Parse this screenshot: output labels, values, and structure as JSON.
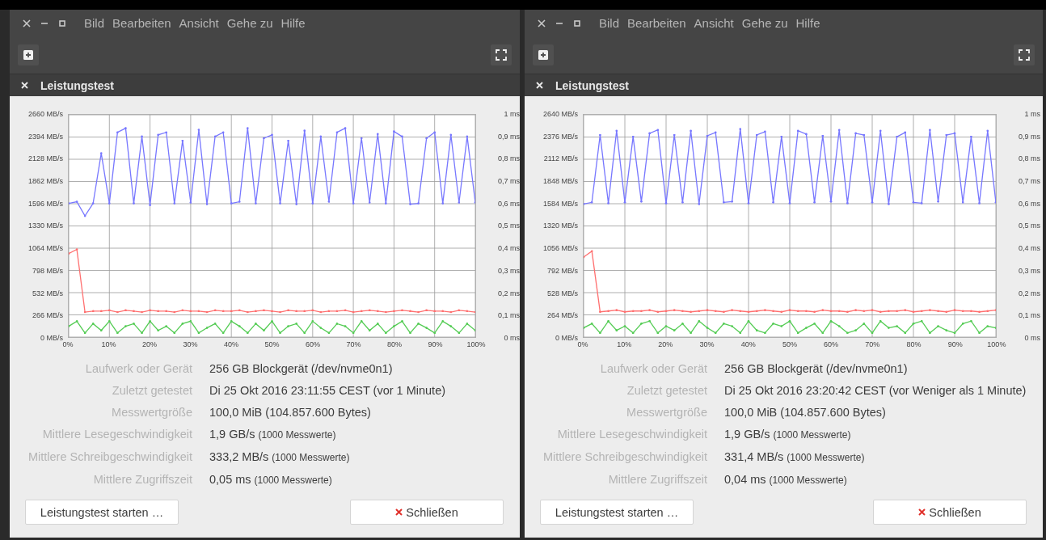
{
  "windows": [
    {
      "menu": [
        "Bild",
        "Bearbeiten",
        "Ansicht",
        "Gehe zu",
        "Hilfe"
      ],
      "dialog_title": "Leistungstest",
      "chart": {
        "y2_labels": [
          "1 ms",
          "0,9 ms",
          "0,8 ms",
          "0,7 ms",
          "0,6 ms",
          "0,5 ms",
          "0,4 ms",
          "0,3 ms",
          "0,2 ms",
          "0,1 ms",
          "0 ms"
        ],
        "chart_data": {
          "type": "line",
          "grid": true,
          "xlim": [
            0,
            100
          ],
          "ylim": [
            0,
            2660
          ],
          "x": [
            0,
            2,
            4,
            6,
            8,
            10,
            12,
            14,
            16,
            18,
            20,
            22,
            24,
            26,
            28,
            30,
            32,
            34,
            36,
            38,
            40,
            42,
            44,
            46,
            48,
            50,
            52,
            54,
            56,
            58,
            60,
            62,
            64,
            66,
            68,
            70,
            72,
            74,
            76,
            78,
            80,
            82,
            84,
            86,
            88,
            90,
            92,
            94,
            96,
            98,
            100
          ],
          "xticks": [
            {
              "value": 0,
              "label": "0%"
            },
            {
              "value": 10,
              "label": "10%"
            },
            {
              "value": 20,
              "label": "20%"
            },
            {
              "value": 30,
              "label": "30%"
            },
            {
              "value": 40,
              "label": "40%"
            },
            {
              "value": 50,
              "label": "50%"
            },
            {
              "value": 60,
              "label": "60%"
            },
            {
              "value": 70,
              "label": "70%"
            },
            {
              "value": 80,
              "label": "80%"
            },
            {
              "value": 90,
              "label": "90%"
            },
            {
              "value": 100,
              "label": "100%"
            }
          ],
          "yticks": [
            {
              "value": 2660,
              "label": "2660 MB/s"
            },
            {
              "value": 2394,
              "label": "2394 MB/s"
            },
            {
              "value": 2128,
              "label": "2128 MB/s"
            },
            {
              "value": 1862,
              "label": "1862 MB/s"
            },
            {
              "value": 1596,
              "label": "1596 MB/s"
            },
            {
              "value": 1330,
              "label": "1330 MB/s"
            },
            {
              "value": 1064,
              "label": "1064 MB/s"
            },
            {
              "value": 798,
              "label": "798 MB/s"
            },
            {
              "value": 532,
              "label": "532 MB/s"
            },
            {
              "value": 266,
              "label": "266 MB/s"
            },
            {
              "value": 0,
              "label": "0 MB/s"
            }
          ],
          "series": [
            {
              "color": "#7878ff",
              "values": [
                1600,
                1620,
                1450,
                1600,
                2200,
                1600,
                2450,
                2500,
                1600,
                2400,
                1580,
                2420,
                2450,
                1600,
                2350,
                1610,
                2480,
                1590,
                2400,
                2450,
                1600,
                1620,
                2500,
                1600,
                2380,
                2420,
                1600,
                2350,
                1590,
                2470,
                1600,
                2400,
                1620,
                2450,
                2500,
                1600,
                2380,
                1610,
                2430,
                1600,
                2460,
                2400,
                1590,
                1600,
                2380,
                2450,
                1600,
                2420,
                1610,
                2400,
                1610
              ]
            },
            {
              "color": "#ff7070",
              "values": [
                1000,
                1050,
                300,
                310,
                310,
                320,
                300,
                320,
                310,
                300,
                320,
                310,
                310,
                300,
                320,
                310,
                310,
                300,
                320,
                310,
                310,
                320,
                300,
                310,
                320,
                310,
                300,
                320,
                310,
                310,
                320,
                300,
                310,
                310,
                320,
                300,
                310,
                320,
                310,
                300,
                310,
                320,
                310,
                300,
                320,
                310,
                310,
                300,
                320,
                310,
                300
              ]
            },
            {
              "color": "#55cc55",
              "values": [
                130,
                190,
                50,
                160,
                80,
                190,
                50,
                130,
                160,
                50,
                190,
                80,
                130,
                50,
                160,
                190,
                50,
                110,
                160,
                50,
                190,
                130,
                50,
                160,
                80,
                190,
                50,
                130,
                160,
                50,
                190,
                110,
                50,
                160,
                130,
                50,
                190,
                80,
                160,
                50,
                130,
                190,
                50,
                160,
                110,
                50,
                190,
                130,
                50,
                160,
                80
              ]
            }
          ]
        }
      },
      "details": [
        {
          "label": "Laufwerk oder Gerät",
          "value": "256 GB Blockgerät (/dev/nvme0n1)"
        },
        {
          "label": "Zuletzt getestet",
          "value": "Di 25 Okt 2016 23:11:55 CEST (vor 1 Minute)"
        },
        {
          "label": "Messwertgröße",
          "value": "100,0 MiB (104.857.600 Bytes)"
        },
        {
          "label": "Mittlere Lesegeschwindigkeit",
          "value": "1,9 GB/s",
          "note": "(1000 Messwerte)"
        },
        {
          "label": "Mittlere Schreibgeschwindigkeit",
          "value": "333,2 MB/s",
          "note": "(1000 Messwerte)"
        },
        {
          "label": "Mittlere Zugriffszeit",
          "value": "0,05 ms",
          "note": "(1000 Messwerte)"
        }
      ],
      "buttons": [
        {
          "kind": "start",
          "label": "Leistungstest starten …"
        },
        {
          "kind": "close",
          "label": "Schließen"
        }
      ]
    },
    {
      "menu": [
        "Bild",
        "Bearbeiten",
        "Ansicht",
        "Gehe zu",
        "Hilfe"
      ],
      "dialog_title": "Leistungstest",
      "chart": {
        "y2_labels": [
          "1 ms",
          "0,9 ms",
          "0,8 ms",
          "0,7 ms",
          "0,6 ms",
          "0,5 ms",
          "0,4 ms",
          "0,3 ms",
          "0,2 ms",
          "0,1 ms",
          "0 ms"
        ],
        "chart_data": {
          "type": "line",
          "grid": true,
          "xlim": [
            0,
            100
          ],
          "ylim": [
            0,
            2640
          ],
          "x": [
            0,
            2,
            4,
            6,
            8,
            10,
            12,
            14,
            16,
            18,
            20,
            22,
            24,
            26,
            28,
            30,
            32,
            34,
            36,
            38,
            40,
            42,
            44,
            46,
            48,
            50,
            52,
            54,
            56,
            58,
            60,
            62,
            64,
            66,
            68,
            70,
            72,
            74,
            76,
            78,
            80,
            82,
            84,
            86,
            88,
            90,
            92,
            94,
            96,
            98,
            100
          ],
          "xticks": [
            {
              "value": 0,
              "label": "0%"
            },
            {
              "value": 10,
              "label": "10%"
            },
            {
              "value": 20,
              "label": "20%"
            },
            {
              "value": 30,
              "label": "30%"
            },
            {
              "value": 40,
              "label": "40%"
            },
            {
              "value": 50,
              "label": "50%"
            },
            {
              "value": 60,
              "label": "60%"
            },
            {
              "value": 70,
              "label": "70%"
            },
            {
              "value": 80,
              "label": "80%"
            },
            {
              "value": 90,
              "label": "90%"
            },
            {
              "value": 100,
              "label": "100%"
            }
          ],
          "yticks": [
            {
              "value": 2640,
              "label": "2640 MB/s"
            },
            {
              "value": 2376,
              "label": "2376 MB/s"
            },
            {
              "value": 2112,
              "label": "2112 MB/s"
            },
            {
              "value": 1848,
              "label": "1848 MB/s"
            },
            {
              "value": 1584,
              "label": "1584 MB/s"
            },
            {
              "value": 1320,
              "label": "1320 MB/s"
            },
            {
              "value": 1056,
              "label": "1056 MB/s"
            },
            {
              "value": 792,
              "label": "792 MB/s"
            },
            {
              "value": 528,
              "label": "528 MB/s"
            },
            {
              "value": 264,
              "label": "264 MB/s"
            },
            {
              "value": 0,
              "label": "0 MB/s"
            }
          ],
          "series": [
            {
              "color": "#7878ff",
              "values": [
                1580,
                1600,
                2400,
                1590,
                2450,
                1600,
                2380,
                1610,
                2420,
                2460,
                1590,
                2400,
                1600,
                2450,
                1580,
                2390,
                2430,
                1600,
                1610,
                2470,
                1590,
                2400,
                2440,
                1600,
                2380,
                1590,
                2450,
                2410,
                1600,
                2390,
                1610,
                2460,
                1590,
                2420,
                2400,
                1600,
                2450,
                1580,
                2380,
                2430,
                1600,
                1590,
                2460,
                1610,
                2400,
                2420,
                1600,
                2380,
                1590,
                2450,
                1600
              ]
            },
            {
              "color": "#ff7070",
              "values": [
                950,
                1020,
                300,
                310,
                320,
                300,
                310,
                310,
                320,
                300,
                310,
                320,
                310,
                300,
                310,
                320,
                310,
                300,
                320,
                310,
                300,
                310,
                320,
                310,
                300,
                320,
                310,
                310,
                300,
                320,
                310,
                310,
                300,
                320,
                310,
                320,
                300,
                310,
                310,
                320,
                300,
                310,
                320,
                310,
                300,
                320,
                310,
                310,
                300,
                310,
                320
              ]
            },
            {
              "color": "#55cc55",
              "values": [
                110,
                160,
                50,
                190,
                80,
                130,
                50,
                160,
                190,
                50,
                130,
                80,
                160,
                50,
                190,
                110,
                50,
                160,
                130,
                50,
                190,
                80,
                50,
                160,
                130,
                190,
                50,
                110,
                160,
                50,
                190,
                130,
                50,
                80,
                160,
                50,
                190,
                110,
                130,
                50,
                160,
                190,
                50,
                130,
                80,
                50,
                160,
                190,
                50,
                130,
                110
              ]
            }
          ]
        }
      },
      "details": [
        {
          "label": "Laufwerk oder Gerät",
          "value": "256 GB Blockgerät (/dev/nvme0n1)"
        },
        {
          "label": "Zuletzt getestet",
          "value": "Di 25 Okt 2016 23:20:42 CEST (vor Weniger als 1 Minute)"
        },
        {
          "label": "Messwertgröße",
          "value": "100,0 MiB (104.857.600 Bytes)"
        },
        {
          "label": "Mittlere Lesegeschwindigkeit",
          "value": "1,9 GB/s",
          "note": "(1000 Messwerte)"
        },
        {
          "label": "Mittlere Schreibgeschwindigkeit",
          "value": "331,4 MB/s",
          "note": "(1000 Messwerte)"
        },
        {
          "label": "Mittlere Zugriffszeit",
          "value": "0,04 ms",
          "note": "(1000 Messwerte)"
        }
      ],
      "buttons": [
        {
          "kind": "start",
          "label": "Leistungstest starten …"
        },
        {
          "kind": "close",
          "label": "Schließen"
        }
      ]
    }
  ]
}
